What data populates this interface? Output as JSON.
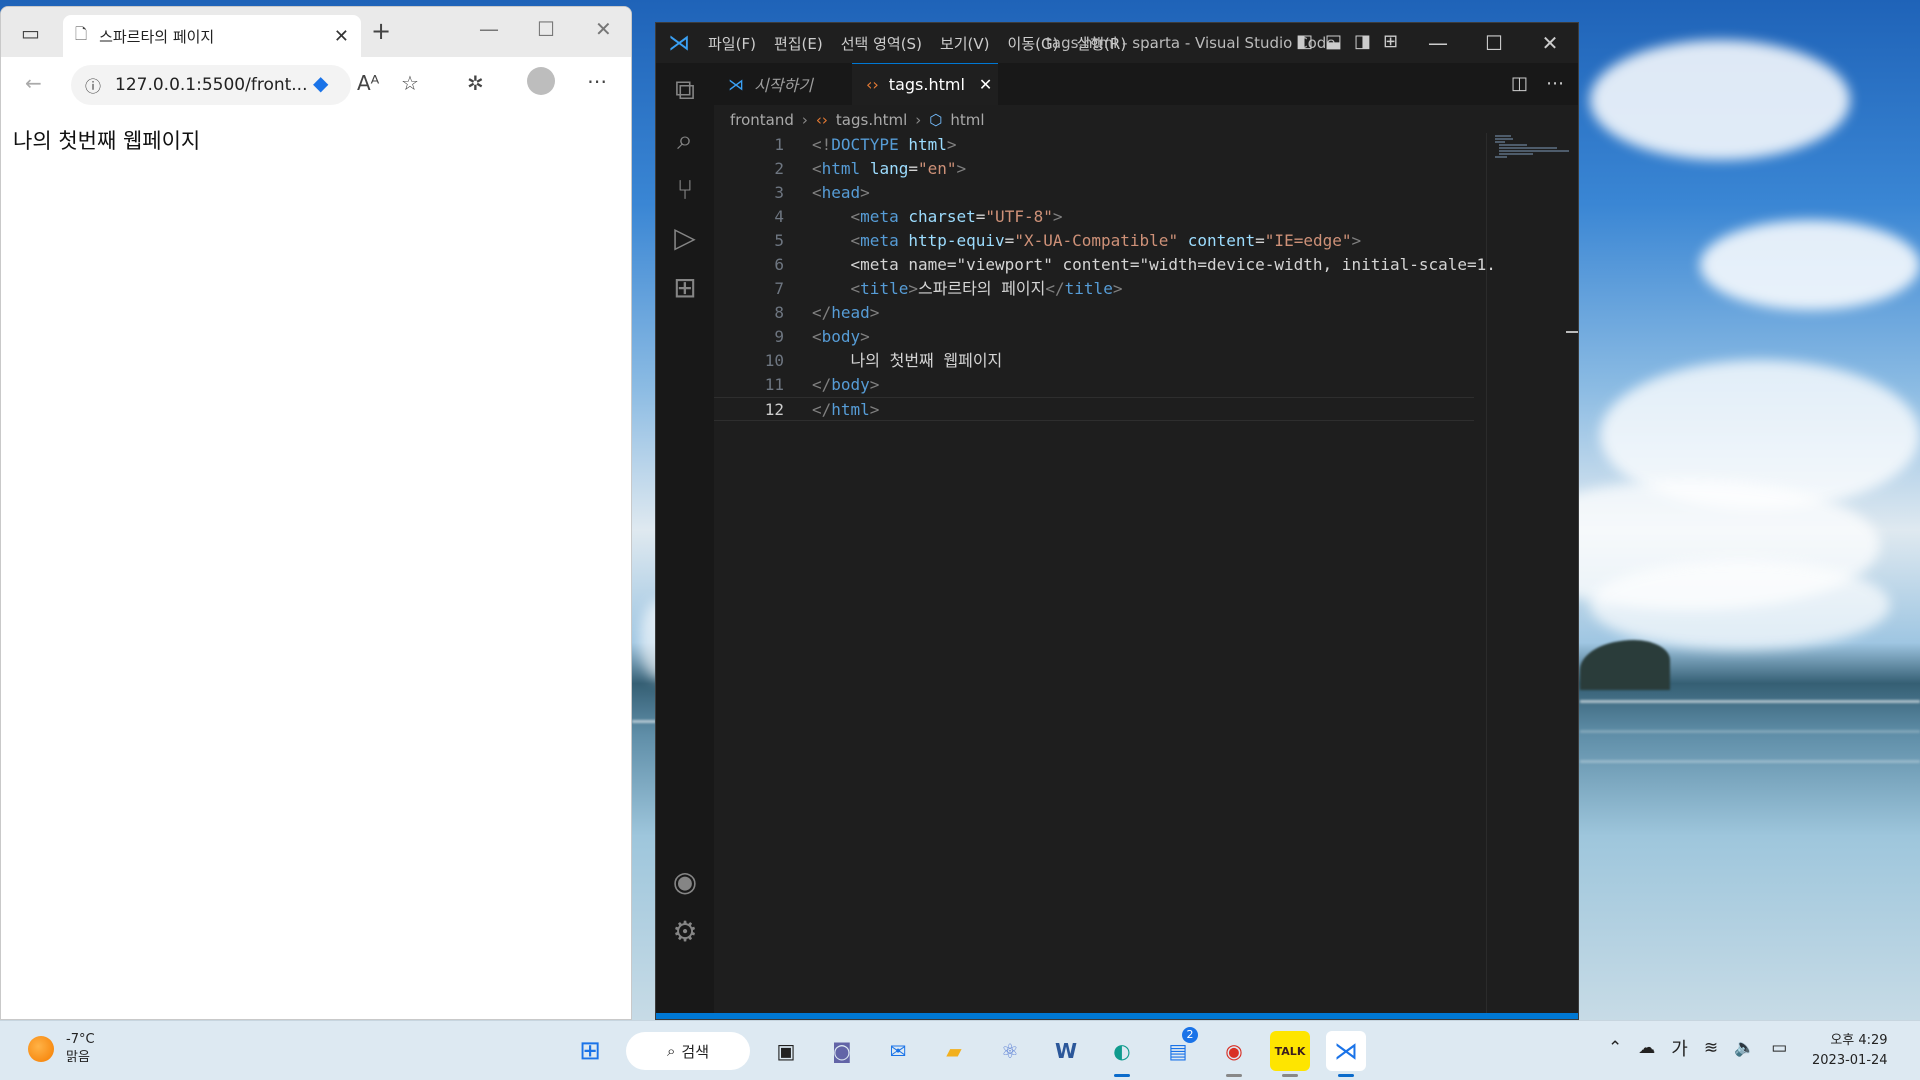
{
  "browser": {
    "tab_title": "스파르타의 페이지",
    "address": "127.0.0.1:5500/front...",
    "page_text": "나의 첫번째 웹페이지"
  },
  "vscode": {
    "menu": [
      "파일(F)",
      "편집(E)",
      "선택 영역(S)",
      "보기(V)",
      "이동(G)",
      "실행(R)",
      "…"
    ],
    "window_title": "tags.html - sparta - Visual Studio Code",
    "tabs": [
      {
        "label": "시작하기",
        "active": false
      },
      {
        "label": "tags.html",
        "active": true
      }
    ],
    "breadcrumb": [
      "frontand",
      "tags.html",
      "html"
    ],
    "code_lines": [
      "<!DOCTYPE html>",
      "<html lang=\"en\">",
      "<head>",
      "    <meta charset=\"UTF-8\">",
      "    <meta http-equiv=\"X-UA-Compatible\" content=\"IE=edge\">",
      "    <meta name=\"viewport\" content=\"width=device-width, initial-scale=1.",
      "    <title>스파르타의 페이지</title>",
      "</head>",
      "<body>",
      "    나의 첫번째 웹페이지",
      "</body>",
      "</html>"
    ],
    "current_line": 12
  },
  "taskbar": {
    "temperature": "-7°C",
    "weather": "맑음",
    "search_label": "검색",
    "teams_badge": "2",
    "tray_ime": "가",
    "time": "오후 4:29",
    "date": "2023-01-24"
  }
}
